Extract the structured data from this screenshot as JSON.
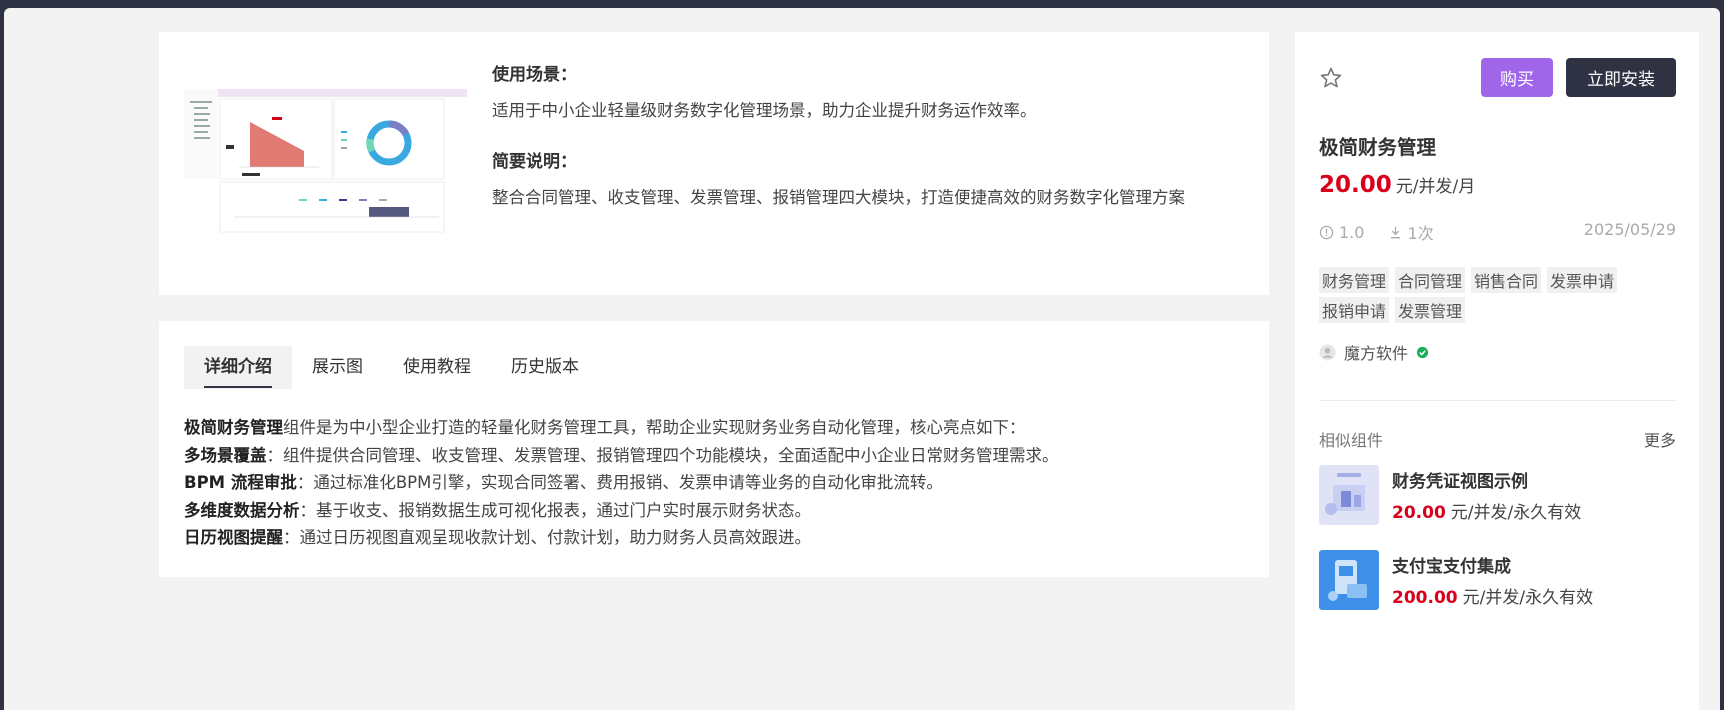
{
  "overview": {
    "scene_heading": "使用场景：",
    "scene_text": "适用于中小企业轻量级财务数字化管理场景，助力企业提升财务运作效率。",
    "brief_heading": "简要说明：",
    "brief_text": "整合合同管理、收支管理、发票管理、报销管理四大模块，打造便捷高效的财务数字化管理方案"
  },
  "tabs": [
    {
      "label": "详细介绍",
      "active": true
    },
    {
      "label": "展示图"
    },
    {
      "label": "使用教程"
    },
    {
      "label": "历史版本"
    }
  ],
  "description": [
    {
      "bold": "极简财务管理",
      "text": "组件是为中小型企业打造的轻量化财务管理工具，帮助企业实现财务业务自动化管理，核心亮点如下："
    },
    {
      "bold": "多场景覆盖",
      "text": "：组件提供合同管理、收支管理、发票管理、报销管理四个功能模块，全面适配中小企业日常财务管理需求。"
    },
    {
      "bold": "BPM 流程审批",
      "text": "：通过标准化BPM引擎，实现合同签署、费用报销、发票申请等业务的自动化审批流转。"
    },
    {
      "bold": "多维度数据分析",
      "text": "：基于收支、报销数据生成可视化报表，通过门户实时展示财务状态。"
    },
    {
      "bold": "日历视图提醒",
      "text": "：通过日历视图直观呈现收款计划、付款计划，助力财务人员高效跟进。"
    }
  ],
  "product": {
    "buy_label": "购买",
    "install_label": "立即安装",
    "title": "极简财务管理",
    "price": "20.00",
    "price_unit": "元/并发/月",
    "version": "1.0",
    "downloads": "1次",
    "date": "2025/05/29",
    "tags": [
      "财务管理",
      "合同管理",
      "销售合同",
      "发票申请",
      "报销申请",
      "发票管理"
    ],
    "author": "魔方软件"
  },
  "similar": {
    "heading": "相似组件",
    "more": "更多",
    "items": [
      {
        "name": "财务凭证视图示例",
        "price": "20.00",
        "unit": "元/并发/永久有效"
      },
      {
        "name": "支付宝支付集成",
        "price": "200.00",
        "unit": "元/并发/永久有效"
      }
    ]
  },
  "colors": {
    "accent_purple": "#a066ea",
    "dark_navy": "#2e3242",
    "price_red": "#d9001b",
    "verified_green": "#1aad5b"
  }
}
